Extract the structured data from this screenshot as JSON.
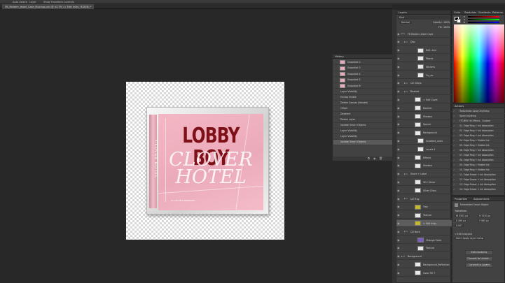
{
  "options_bar": {
    "items": [
      "Auto-Select:",
      "Layer",
      "Show Transform Controls"
    ]
  },
  "document_tab": {
    "label": "FB_Modern_Jewel_Case_Mockup.psd @ 43.3% (< Edit Inlay, RGB/8) *"
  },
  "artwork": {
    "title": "LOBBY BOY",
    "subtitle_line1": "CLOVER",
    "subtitle_line2": "HOTEL",
    "spine_text": "CLOVER HOTEL",
    "fine_print": "ALL RIGHTS RESERVED"
  },
  "history_panel": {
    "tab": "History",
    "snapshots": [
      "Snapshot 2",
      "Snapshot 3",
      "Snapshot 4",
      "Snapshot 5",
      "Snapshot 6"
    ],
    "steps": [
      "Layer Visibility",
      "Enclap Visible",
      "Delete Canvas (Nondel)",
      "Offset",
      "Deselect",
      "Delete Layer",
      "Update Smart Objects",
      "Layer Visibility",
      "Layer Visibility",
      "Update Smart Objects"
    ]
  },
  "layers_panel": {
    "tab": "Layers",
    "kind": "Kind",
    "blend": "Normal",
    "opacity": "100%",
    "fill": "100%",
    "rows": [
      {
        "name": "FB Modern Jewel Case",
        "indent": 4
      },
      {
        "name": "Disc",
        "indent": 8
      },
      {
        "name": "Refl. and",
        "indent": 22
      },
      {
        "name": "Plastic",
        "indent": 22
      },
      {
        "name": "Stickers",
        "indent": 22
      },
      {
        "name": "On_up",
        "indent": 22
      },
      {
        "name": "CD Inlays",
        "indent": 8
      },
      {
        "name": "Booklet",
        "indent": 8
      },
      {
        "name": "< Edit Cover",
        "indent": 18
      },
      {
        "name": "Booklet",
        "indent": 18
      },
      {
        "name": "Shadow",
        "indent": 18
      },
      {
        "name": "Spacer",
        "indent": 18
      },
      {
        "name": "Background",
        "indent": 18
      },
      {
        "name": "Gradient_color",
        "indent": 22
      },
      {
        "name": "Levels 1",
        "indent": 22
      },
      {
        "name": "Effects",
        "indent": 18
      },
      {
        "name": "Shadow",
        "indent": 18
      },
      {
        "name": "Shore + Label",
        "indent": 8
      },
      {
        "name": "3D / Shine",
        "indent": 18
      },
      {
        "name": "Silver Discs",
        "indent": 18
      },
      {
        "name": "CD Tray",
        "indent": 8
      },
      {
        "name": "Tray",
        "indent": 18
      },
      {
        "name": "Texture",
        "indent": 18
      },
      {
        "name": "< Edit Inlay",
        "indent": 18
      },
      {
        "name": "CD Back",
        "indent": 8
      },
      {
        "name": "Change Color",
        "indent": 22
      },
      {
        "name": "Texture",
        "indent": 22
      },
      {
        "name": "Background",
        "indent": 4
      },
      {
        "name": "Background_Reflection",
        "indent": 18
      },
      {
        "name": "Color Fill 7",
        "indent": 18
      }
    ]
  },
  "color_panel": {
    "tabs": [
      "Color",
      "Swatches",
      "Gradients",
      "Patterns"
    ],
    "channels": [
      "R",
      "G",
      "B"
    ]
  },
  "actions_panel": {
    "tab": "Actions",
    "items": [
      "Texturelabs Spray Anything",
      "Spray Anything",
      "FTCMKS HA Effects - Custom",
      "01. Edge Ring + Ink Absorption",
      "02. Edge Ring + Ink Absorption",
      "03. Edge Ring + Ink Absorption",
      "04. Edge Ring + Matted Ink",
      "05. Edge Ring + Matted Ink",
      "06. Edge Ring + Ink Absorption",
      "07. Edge Ring + Ink Absorption",
      "08. Edge Ring + Ink Absorption",
      "09. Edge Ring + Matted Ink",
      "10. Edge Ring + Matted Ink",
      "11. Edge Smear + Ink Absorption",
      "12. Edge Smear + Ink Absorption",
      "13. Edge Smear + Ink Absorption",
      "14. Edge Smear + Ink Absorption"
    ]
  },
  "properties_panel": {
    "tabs": [
      "Properties",
      "Adjustments"
    ],
    "object_type": "Embedded Smart Object",
    "section": "Transform",
    "w": "W 3502 px",
    "h": "H 3150 px",
    "x": "X 490 px",
    "y": "Y 985 px",
    "angle": "0.00°",
    "layer_comp": "< Edit Inlay.psd",
    "layer_comp_sub": "Don't Apply Layer Comp",
    "buttons": [
      "Edit Contents",
      "Convert to Linked...",
      "Convert to Layers"
    ]
  },
  "colors": {
    "cover_pink": "#eeacbb",
    "title_red": "#7e1018",
    "layer_yellow": "#c7b52a",
    "layer_purple": "#7a5cc4"
  }
}
